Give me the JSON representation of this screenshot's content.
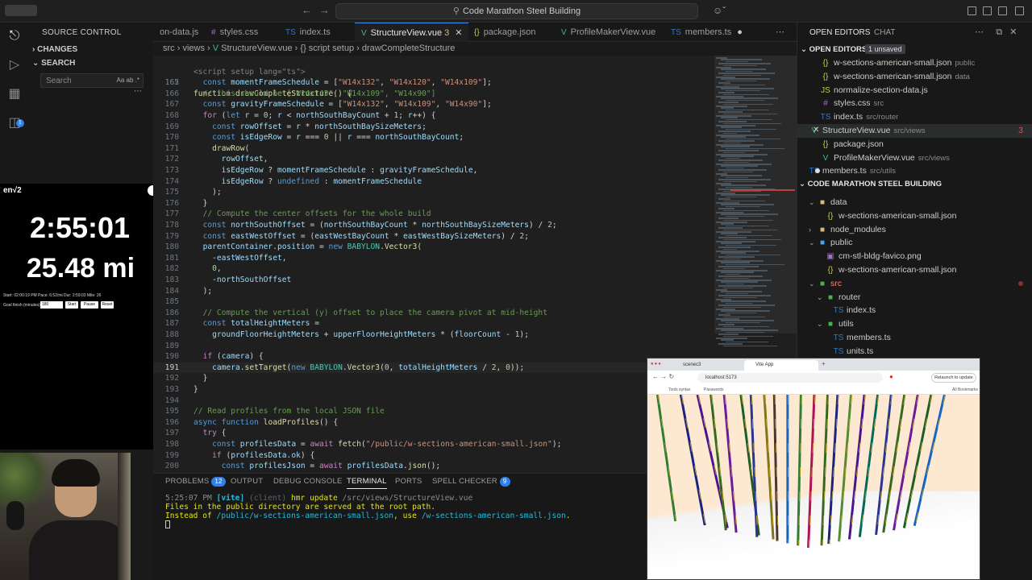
{
  "titlebar": {
    "search_text": "Code Marathon Steel Building",
    "back": "←",
    "forward": "→"
  },
  "sidebar": {
    "title": "SOURCE CONTROL",
    "changes": "CHANGES",
    "search_section": "SEARCH",
    "search_placeholder": "Search",
    "search_opts": "Aa ab .*"
  },
  "overlay": {
    "brand": "en√2",
    "elapsed": "2:55:01",
    "distance": "25.48 mi",
    "stats_line": "Start: 02:00:19 PM   Pace: 6:52/mi   Dur: 2:59:03   Mile: 26",
    "goal_label": "Goal finish (minutes):",
    "goal_value": "180",
    "start_btn": "Start",
    "pause_btn": "Pause",
    "reset_btn": "Reset"
  },
  "tabs": [
    {
      "label": "on-data.js",
      "icon": "JS",
      "kind": "js"
    },
    {
      "label": "styles.css",
      "icon": "#",
      "kind": "css"
    },
    {
      "label": "index.ts",
      "icon": "TS",
      "kind": "ts"
    },
    {
      "label": "StructureView.vue",
      "icon": "V",
      "kind": "vue",
      "active": true,
      "problems": "3"
    },
    {
      "label": "package.json",
      "icon": "{}",
      "kind": "json"
    },
    {
      "label": "ProfileMakerView.vue",
      "icon": "V",
      "kind": "vue"
    },
    {
      "label": "members.ts",
      "icon": "TS",
      "kind": "ts",
      "dirty": "●"
    }
  ],
  "breadcrumb": {
    "p1": "src",
    "p2": "views",
    "p3": "StructureView.vue",
    "p4": "{} script setup",
    "p5": "drawCompleteStructure"
  },
  "sticky": {
    "line1": "<script setup lang=\"ts\">",
    "line2_ln": "162",
    "line2": "function drawCompleteStructure() {"
  },
  "code_lines": [
    {
      "ln": "165",
      "text": "  const momentFrameSchedule = [\"W14x132\", \"W14x120\", \"W14x109\"];"
    },
    {
      "ln": "166",
      "text": "  // this should be [\"W14x145\", \"W14x109\", \"W14x90\"]"
    },
    {
      "ln": "167",
      "text": "  const gravityFrameSchedule = [\"W14x132\", \"W14x109\", \"W14x90\"];"
    },
    {
      "ln": "168",
      "text": "  for (let r = 0; r < northSouthBayCount + 1; r++) {"
    },
    {
      "ln": "169",
      "text": "    const rowOffset = r * northSouthBaySizeMeters;"
    },
    {
      "ln": "170",
      "text": "    const isEdgeRow = r === 0 || r === northSouthBayCount;"
    },
    {
      "ln": "171",
      "text": "    drawRow("
    },
    {
      "ln": "172",
      "text": "      rowOffset,"
    },
    {
      "ln": "173",
      "text": "      isEdgeRow ? momentFrameSchedule : gravityFrameSchedule,"
    },
    {
      "ln": "174",
      "text": "      isEdgeRow ? undefined : momentFrameSchedule"
    },
    {
      "ln": "175",
      "text": "    );"
    },
    {
      "ln": "176",
      "text": "  }"
    },
    {
      "ln": "177",
      "text": "  // Compute the center offsets for the whole build"
    },
    {
      "ln": "178",
      "text": "  const northSouthOffset = (northSouthBayCount * northSouthBaySizeMeters) / 2;"
    },
    {
      "ln": "179",
      "text": "  const eastWestOffset = (eastWestBayCount * eastWestBaySizeMeters) / 2;"
    },
    {
      "ln": "180",
      "text": "  parentContainer.position = new BABYLON.Vector3("
    },
    {
      "ln": "181",
      "text": "    -eastWestOffset,"
    },
    {
      "ln": "182",
      "text": "    0,"
    },
    {
      "ln": "183",
      "text": "    -northSouthOffset"
    },
    {
      "ln": "184",
      "text": "  );"
    },
    {
      "ln": "185",
      "text": ""
    },
    {
      "ln": "186",
      "text": "  // Compute the vertical (y) offset to place the camera pivot at mid-height"
    },
    {
      "ln": "187",
      "text": "  const totalHeightMeters ="
    },
    {
      "ln": "188",
      "text": "    groundFloorHeightMeters + upperFloorHeightMeters * (floorCount - 1);"
    },
    {
      "ln": "189",
      "text": ""
    },
    {
      "ln": "190",
      "text": "  if (camera) {"
    },
    {
      "ln": "191",
      "text": "    camera.setTarget(new BABYLON.Vector3(0, totalHeightMeters / 2, 0));"
    },
    {
      "ln": "192",
      "text": "  }"
    },
    {
      "ln": "193",
      "text": "}"
    },
    {
      "ln": "194",
      "text": ""
    },
    {
      "ln": "195",
      "text": "// Read profiles from the local JSON file"
    },
    {
      "ln": "196",
      "text": "async function loadProfiles() {"
    },
    {
      "ln": "197",
      "text": "  try {"
    },
    {
      "ln": "198",
      "text": "    const profilesData = await fetch(\"/public/w-sections-american-small.json\");"
    },
    {
      "ln": "199",
      "text": "    if (profilesData.ok) {"
    },
    {
      "ln": "200",
      "text": "      const profilesJson = await profilesData.json();"
    }
  ],
  "panel": {
    "problems": "PROBLEMS",
    "problems_count": "12",
    "output": "OUTPUT",
    "debug": "DEBUG CONSOLE",
    "terminal": "TERMINAL",
    "ports": "PORTS",
    "spell": "SPELL CHECKER",
    "spell_count": "9",
    "t1_time": "5:25:07 PM",
    "t1_tag": "[vite]",
    "t1_client": "(client)",
    "t1_msg": "hmr update",
    "t1_path": "/src/views/StructureView.vue",
    "t2": "Files in the public directory are served at the root path.",
    "t3_a": "Instead of",
    "t3_b": "/public/w-sections-american-small.json",
    "t3_c": ", use",
    "t3_d": "/w-sections-american-small.json",
    "t3_e": "."
  },
  "explorer": {
    "tab_open": "OPEN EDITORS",
    "tab_chat": "CHAT",
    "open_editors_title": "OPEN EDITORS",
    "unsaved": "1 unsaved",
    "open_editors": [
      {
        "name": "w-sections-american-small.json",
        "desc": "public",
        "kind": "json",
        "icon": "{}"
      },
      {
        "name": "w-sections-american-small.json",
        "desc": "data",
        "kind": "json",
        "icon": "{}"
      },
      {
        "name": "normalize-section-data.js",
        "desc": "",
        "kind": "js",
        "icon": "JS"
      },
      {
        "name": "styles.css",
        "desc": "src",
        "kind": "css",
        "icon": "#"
      },
      {
        "name": "index.ts",
        "desc": "src/router",
        "kind": "ts",
        "icon": "TS"
      },
      {
        "name": "StructureView.vue",
        "desc": "src/views",
        "kind": "vue",
        "icon": "V",
        "selected": true,
        "count": "3"
      },
      {
        "name": "package.json",
        "desc": "",
        "kind": "json",
        "icon": "{}"
      },
      {
        "name": "ProfileMakerView.vue",
        "desc": "src/views",
        "kind": "vue",
        "icon": "V"
      },
      {
        "name": "members.ts",
        "desc": "src/utils",
        "kind": "ts",
        "icon": "TS",
        "dirty": true
      }
    ],
    "project_title": "CODE MARATHON STEEL BUILDING",
    "tree": [
      {
        "name": "data",
        "indent": 1,
        "kind": "folder",
        "chev": "⌄",
        "icon": "■"
      },
      {
        "name": "w-sections-american-small.json",
        "indent": 2,
        "kind": "json",
        "icon": "{}"
      },
      {
        "name": "node_modules",
        "indent": 1,
        "kind": "folder",
        "chev": "›",
        "icon": "■"
      },
      {
        "name": "public",
        "indent": 1,
        "kind": "fold-pub",
        "chev": "⌄",
        "icon": "■"
      },
      {
        "name": "cm-stl-bldg-favico.png",
        "indent": 2,
        "kind": "img",
        "icon": "▣"
      },
      {
        "name": "w-sections-american-small.json",
        "indent": 2,
        "kind": "json",
        "icon": "{}"
      },
      {
        "name": "src",
        "indent": 1,
        "kind": "fold-src",
        "chev": "⌄",
        "icon": "■",
        "err": true
      },
      {
        "name": "router",
        "indent": 2,
        "kind": "fold-src",
        "chev": "⌄",
        "icon": "■"
      },
      {
        "name": "index.ts",
        "indent": 3,
        "kind": "ts",
        "icon": "TS"
      },
      {
        "name": "utils",
        "indent": 2,
        "kind": "fold-src",
        "chev": "⌄",
        "icon": "■"
      },
      {
        "name": "members.ts",
        "indent": 3,
        "kind": "ts",
        "icon": "TS"
      },
      {
        "name": "units.ts",
        "indent": 3,
        "kind": "ts",
        "icon": "TS"
      }
    ]
  },
  "browser": {
    "tab1": "scenec3",
    "tab2": "Vite App",
    "url": "localhost:5173",
    "relaunch": "Relaunch to update",
    "bookmarks": "All Bookmarks",
    "bm1": "Tools syntax",
    "bm2": "Passwords"
  },
  "columns": [
    {
      "x": 0.03,
      "lean": 0.06,
      "color": "#2e7d32"
    },
    {
      "x": 0.1,
      "lean": 0.08,
      "color": "#1a237e"
    },
    {
      "x": 0.15,
      "lean": 0.1,
      "color": "#4a148c"
    },
    {
      "x": 0.19,
      "lean": 0.05,
      "color": "#33691e"
    },
    {
      "x": 0.23,
      "lean": 0.04,
      "color": "#6a1b9a"
    },
    {
      "x": 0.28,
      "lean": 0.06,
      "color": "#1b5e20"
    },
    {
      "x": 0.31,
      "lean": 0.02,
      "color": "#283593"
    },
    {
      "x": 0.35,
      "lean": 0.03,
      "color": "#827717"
    },
    {
      "x": 0.38,
      "lean": 0.01,
      "color": "#4e342e"
    },
    {
      "x": 0.42,
      "lean": 0.0,
      "color": "#1565c0"
    },
    {
      "x": 0.46,
      "lean": -0.01,
      "color": "#2e7d32"
    },
    {
      "x": 0.5,
      "lean": -0.02,
      "color": "#ad1457"
    },
    {
      "x": 0.54,
      "lean": -0.02,
      "color": "#33691e"
    },
    {
      "x": 0.57,
      "lean": -0.03,
      "color": "#1a237e"
    },
    {
      "x": 0.61,
      "lean": -0.04,
      "color": "#558b2f"
    },
    {
      "x": 0.65,
      "lean": -0.05,
      "color": "#4a148c"
    },
    {
      "x": 0.69,
      "lean": -0.06,
      "color": "#00695c"
    },
    {
      "x": 0.73,
      "lean": -0.05,
      "color": "#283593"
    },
    {
      "x": 0.77,
      "lean": -0.07,
      "color": "#33691e"
    },
    {
      "x": 0.81,
      "lean": -0.08,
      "color": "#6a1b9a"
    },
    {
      "x": 0.85,
      "lean": -0.09,
      "color": "#1b5e20"
    },
    {
      "x": 0.89,
      "lean": -0.1,
      "color": "#1565c0"
    }
  ]
}
